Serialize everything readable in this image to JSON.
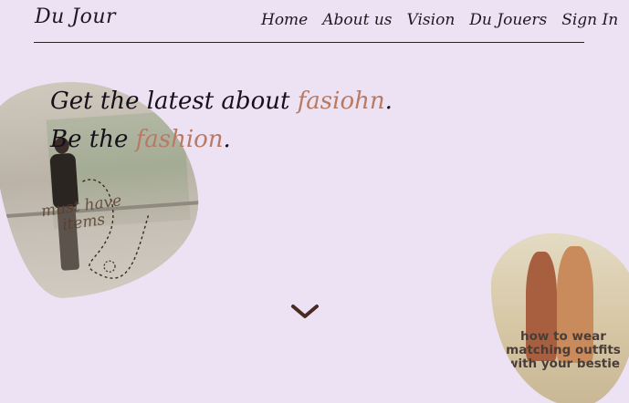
{
  "brand": {
    "logo": "Du Jour"
  },
  "nav": {
    "items": [
      {
        "label": "Home"
      },
      {
        "label": "About us"
      },
      {
        "label": "Vision"
      },
      {
        "label": "Du Jouers"
      },
      {
        "label": "Sign In"
      }
    ]
  },
  "hero": {
    "line1_prefix": "Get the latest about ",
    "line1_accent": "fasiohn",
    "line1_suffix": ".",
    "line2_prefix": "Be the ",
    "line2_accent": "fashion",
    "line2_suffix": "."
  },
  "images": {
    "left_caption_line1": "must have",
    "left_caption_line2": "items",
    "right_caption": "how to wear matching outfits with your bestie"
  },
  "icons": {
    "scroll": "chevron-down-icon"
  },
  "colors": {
    "background": "#ece2f4",
    "accent": "#b87a63",
    "text": "#15101a"
  }
}
